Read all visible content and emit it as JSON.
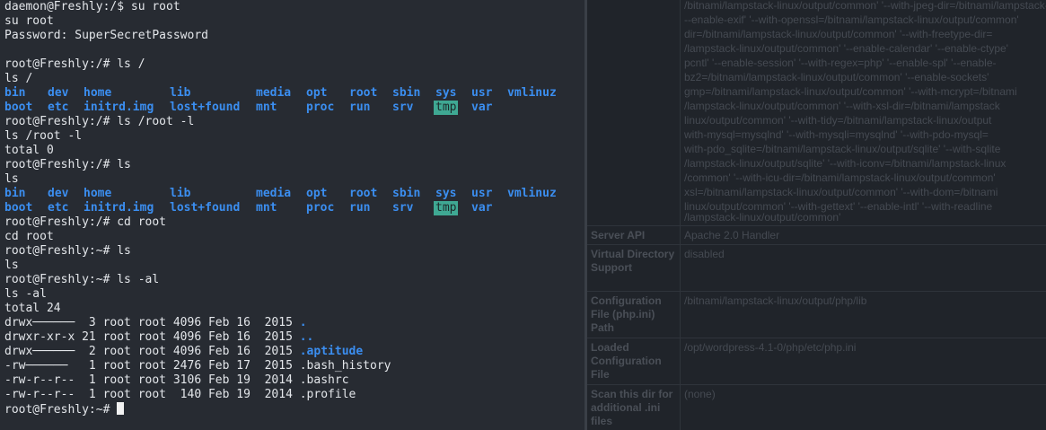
{
  "terminal": {
    "prompt_user": "daemon@Freshly:/$ su root",
    "echo_su": "su root",
    "password_line": "Password: SuperSecretPassword",
    "cmd1": "root@Freshly:/# ls /",
    "echo1": "ls /",
    "root_listing_row1": [
      "bin",
      "dev",
      "home",
      "lib",
      "media",
      "opt",
      "root",
      "sbin",
      "sys",
      "usr",
      "vmlinuz"
    ],
    "root_listing_row2": [
      "boot",
      "etc",
      "initrd.img",
      "lost+found",
      "mnt",
      "proc",
      "run",
      "srv",
      "tmp",
      "var"
    ],
    "cmd2": "root@Freshly:/# ls /root -l",
    "echo2": "ls /root -l",
    "total0": "total 0",
    "cmd3": "root@Freshly:/# ls",
    "echo3": "ls",
    "cmd4": "root@Freshly:/# cd root",
    "echo4": "cd root",
    "cmd5": "root@Freshly:~# ls",
    "echo5": "ls",
    "cmd6": "root@Freshly:~# ls -al",
    "echo6": "ls -al",
    "total24": "total 24",
    "files": [
      {
        "perms": "drwx──────  3 root root 4096 Feb 16  2015 ",
        "name": "."
      },
      {
        "perms": "drwxr-xr-x 21 root root 4096 Feb 16  2015 ",
        "name": ".."
      },
      {
        "perms": "drwx──────  2 root root 4096 Feb 16  2015 ",
        "name": ".aptitude"
      },
      {
        "perms": "-rw──────   1 root root 2476 Feb 17  2015 ",
        "name": ".bash_history"
      },
      {
        "perms": "-rw-r--r--  1 root root 3106 Feb 19  2014 ",
        "name": ".bashrc"
      },
      {
        "perms": "-rw-r--r--  1 root root  140 Feb 19  2014 ",
        "name": ".profile"
      }
    ],
    "final_prompt": "root@Freshly:~# "
  },
  "php_info": {
    "config_lines": [
      "/bitnami/lampstack-linux/output/common' '--with-jpeg-dir=/bitnami/lampstack-linux/output",
      "--enable-exif' '--with-openssl=/bitnami/lampstack-linux/output/common'",
      "dir=/bitnami/lampstack-linux/output/common' '--with-freetype-dir=",
      "/lampstack-linux/output/common' '--enable-calendar' '--enable-ctype'",
      "pcntl' '--enable-session' '--with-regex=php' '--enable-spl' '--enable-",
      "bz2=/bitnami/lampstack-linux/output/common' '--enable-sockets'",
      "gmp=/bitnami/lampstack-linux/output/common' '--with-mcrypt=/bitnami",
      "/lampstack-linux/output/common' '--with-xsl-dir=/bitnami/lampstack",
      "linux/output/common' '--with-tidy=/bitnami/lampstack-linux/output",
      "with-mysql=mysqlnd' '--with-mysqli=mysqlnd' '--with-pdo-mysql=",
      "with-pdo_sqlite=/bitnami/lampstack-linux/output/sqlite' '--with-sqlite",
      "/lampstack-linux/output/sqlite' '--with-iconv=/bitnami/lampstack-linux",
      "/common' '--with-icu-dir=/bitnami/lampstack-linux/output/common'",
      "xsl=/bitnami/lampstack-linux/output/common' '--with-dom=/bitnami",
      "linux/output/common' '--with-gettext' '--enable-intl' '--with-readline",
      "/lampstack-linux/output/common'"
    ],
    "rows": [
      {
        "key": "Server API",
        "value": "Apache 2.0 Handler"
      },
      {
        "key": "Virtual Directory Support",
        "value": "disabled"
      },
      {
        "key": "Configuration File (php.ini) Path",
        "value": "/bitnami/lampstack-linux/output/php/lib"
      },
      {
        "key": "Loaded Configuration File",
        "value": "/opt/wordpress-4.1-0/php/etc/php.ini"
      },
      {
        "key": "Scan this dir for additional .ini files",
        "value": "(none)"
      }
    ]
  },
  "colors": {
    "terminal_bg": "#272b32",
    "text": "#e3e6ea",
    "directory": "#3b8ef0",
    "sticky_dir_bg": "#3fa893"
  }
}
